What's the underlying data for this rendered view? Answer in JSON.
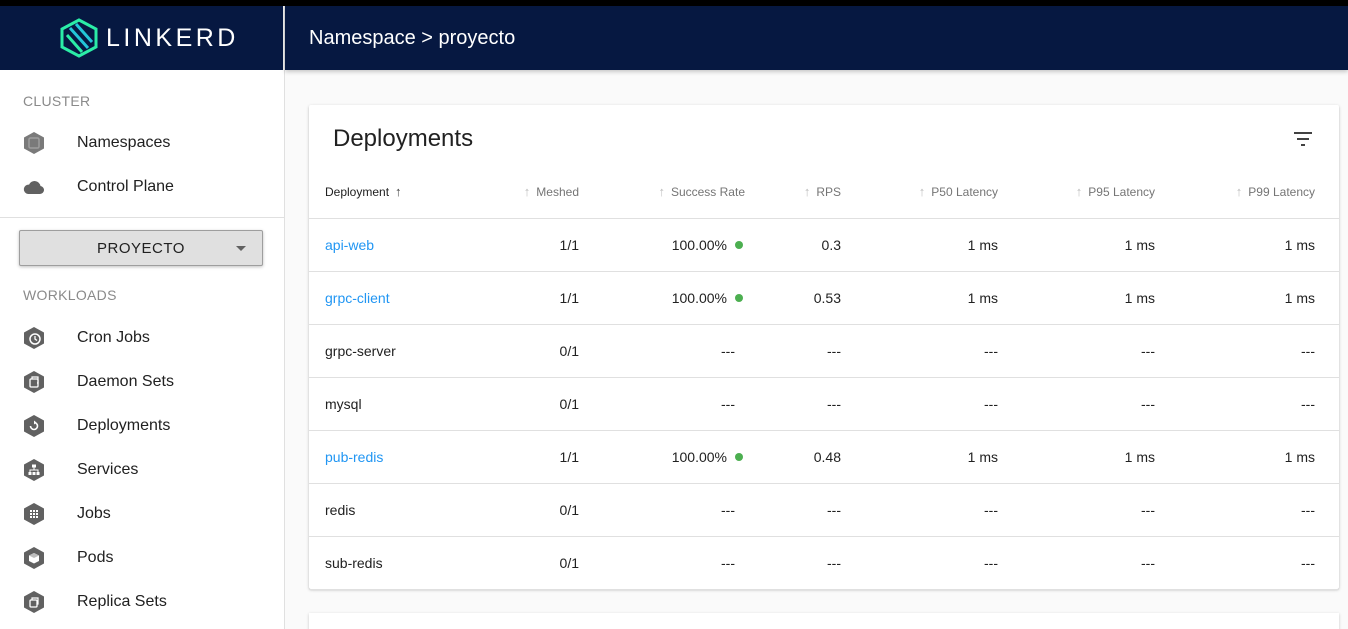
{
  "brand": {
    "name": "LINKERD"
  },
  "header": {
    "breadcrumb": "Namespace > proyecto"
  },
  "sidebar": {
    "cluster_label": "CLUSTER",
    "cluster_items": [
      {
        "label": "Namespaces",
        "icon": "namespace-icon"
      },
      {
        "label": "Control Plane",
        "icon": "cloud-icon"
      }
    ],
    "namespace_select": "PROYECTO",
    "workloads_label": "WORKLOADS",
    "workload_items": [
      {
        "label": "Cron Jobs",
        "icon": "cron-job-icon"
      },
      {
        "label": "Daemon Sets",
        "icon": "daemon-set-icon"
      },
      {
        "label": "Deployments",
        "icon": "deployment-icon"
      },
      {
        "label": "Services",
        "icon": "service-icon"
      },
      {
        "label": "Jobs",
        "icon": "job-icon"
      },
      {
        "label": "Pods",
        "icon": "pod-icon"
      },
      {
        "label": "Replica Sets",
        "icon": "replica-set-icon"
      }
    ]
  },
  "main": {
    "card_title": "Deployments",
    "columns": [
      "Deployment",
      "Meshed",
      "Success Rate",
      "RPS",
      "P50 Latency",
      "P95 Latency",
      "P99 Latency"
    ],
    "rows": [
      {
        "name": "api-web",
        "link": true,
        "meshed": "1/1",
        "success_rate": "100.00%",
        "status": "green",
        "rps": "0.3",
        "p50": "1 ms",
        "p95": "1 ms",
        "p99": "1 ms"
      },
      {
        "name": "grpc-client",
        "link": true,
        "meshed": "1/1",
        "success_rate": "100.00%",
        "status": "green",
        "rps": "0.53",
        "p50": "1 ms",
        "p95": "1 ms",
        "p99": "1 ms"
      },
      {
        "name": "grpc-server",
        "link": false,
        "meshed": "0/1",
        "success_rate": "---",
        "status": "",
        "rps": "---",
        "p50": "---",
        "p95": "---",
        "p99": "---"
      },
      {
        "name": "mysql",
        "link": false,
        "meshed": "0/1",
        "success_rate": "---",
        "status": "",
        "rps": "---",
        "p50": "---",
        "p95": "---",
        "p99": "---"
      },
      {
        "name": "pub-redis",
        "link": true,
        "meshed": "1/1",
        "success_rate": "100.00%",
        "status": "green",
        "rps": "0.48",
        "p50": "1 ms",
        "p95": "1 ms",
        "p99": "1 ms"
      },
      {
        "name": "redis",
        "link": false,
        "meshed": "0/1",
        "success_rate": "---",
        "status": "",
        "rps": "---",
        "p50": "---",
        "p95": "---",
        "p99": "---"
      },
      {
        "name": "sub-redis",
        "link": false,
        "meshed": "0/1",
        "success_rate": "---",
        "status": "",
        "rps": "---",
        "p50": "---",
        "p95": "---",
        "p99": "---"
      }
    ]
  },
  "colors": {
    "header_bg": "#061841",
    "link": "#2196f3",
    "status_green": "#4caf50",
    "logo_accent": "#2beda7"
  }
}
